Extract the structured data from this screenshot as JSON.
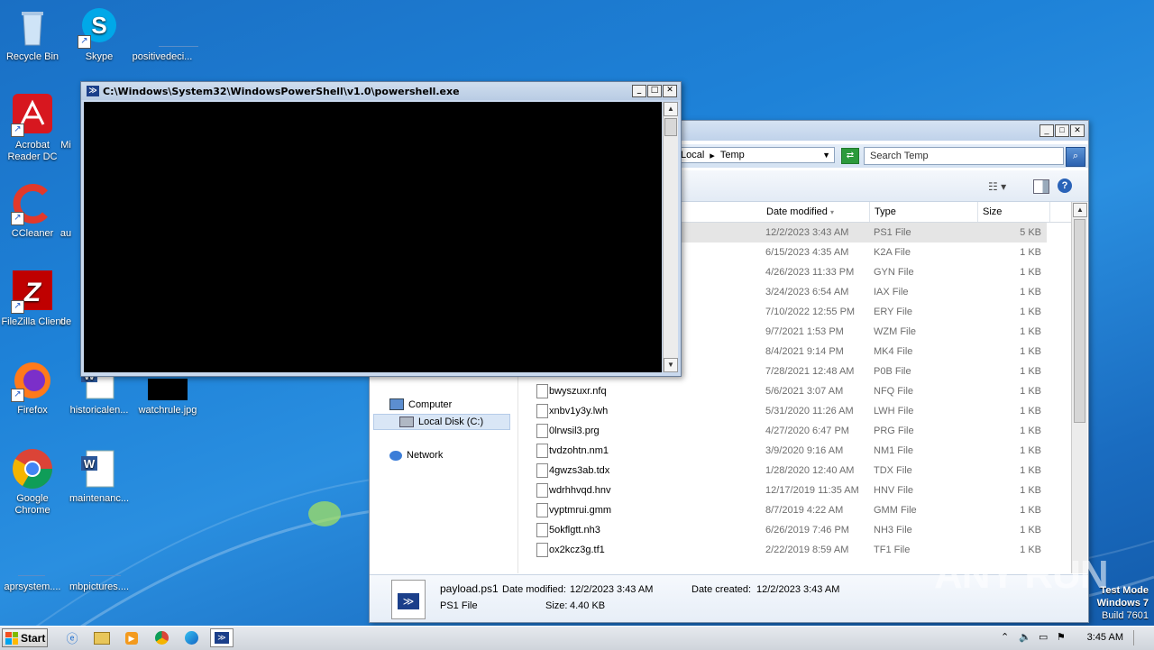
{
  "desktop": {
    "icons": [
      {
        "label": "Recycle Bin",
        "icon": "recycle-bin-icon"
      },
      {
        "label": "Skype",
        "icon": "skype-icon"
      },
      {
        "label": "positivedeci...",
        "icon": "file-icon"
      },
      {
        "label": "Acrobat Reader DC",
        "icon": "acrobat-icon"
      },
      {
        "label": "Mi",
        "icon": "file-icon"
      },
      {
        "label": "CCleaner",
        "icon": "ccleaner-icon"
      },
      {
        "label": "au",
        "icon": "file-icon"
      },
      {
        "label": "FileZilla Client",
        "icon": "filezilla-icon"
      },
      {
        "label": "de",
        "icon": "file-icon"
      },
      {
        "label": "Firefox",
        "icon": "firefox-icon"
      },
      {
        "label": "historicalen...",
        "icon": "word-doc-icon"
      },
      {
        "label": "watchrule.jpg",
        "icon": "image-icon"
      },
      {
        "label": "Google Chrome",
        "icon": "chrome-icon"
      },
      {
        "label": "maintenanc...",
        "icon": "word-doc-icon"
      },
      {
        "label": "aprsystem....",
        "icon": "file-icon"
      },
      {
        "label": "mbpictures....",
        "icon": "file-icon"
      }
    ]
  },
  "powershell": {
    "title": "C:\\Windows\\System32\\WindowsPowerShell\\v1.0\\powershell.exe",
    "btn_min": "_",
    "btn_max": "□",
    "btn_close": "✕"
  },
  "explorer": {
    "btn_min": "_",
    "btn_max": "□",
    "btn_close": "✕",
    "breadcrumb": [
      "Local",
      "Temp"
    ],
    "search_placeholder": "Search Temp",
    "columns": {
      "date": "Date modified",
      "type": "Type",
      "size": "Size"
    },
    "nav": {
      "computer": "Computer",
      "local_disk": "Local Disk (C:)",
      "network": "Network"
    },
    "rows": [
      {
        "name": "",
        "date": "12/2/2023 3:43 AM",
        "type": "PS1 File",
        "size": "5 KB",
        "selected": true
      },
      {
        "name": "",
        "date": "6/15/2023 4:35 AM",
        "type": "K2A File",
        "size": "1 KB"
      },
      {
        "name": "",
        "date": "4/26/2023 11:33 PM",
        "type": "GYN File",
        "size": "1 KB"
      },
      {
        "name": "",
        "date": "3/24/2023 6:54 AM",
        "type": "IAX File",
        "size": "1 KB"
      },
      {
        "name": "",
        "date": "7/10/2022 12:55 PM",
        "type": "ERY File",
        "size": "1 KB"
      },
      {
        "name": "",
        "date": "9/7/2021 1:53 PM",
        "type": "WZM File",
        "size": "1 KB"
      },
      {
        "name": "",
        "date": "8/4/2021 9:14 PM",
        "type": "MK4 File",
        "size": "1 KB"
      },
      {
        "name": "",
        "date": "7/28/2021 12:48 AM",
        "type": "P0B File",
        "size": "1 KB"
      },
      {
        "name": "bwyszuxr.nfq",
        "date": "5/6/2021 3:07 AM",
        "type": "NFQ File",
        "size": "1 KB"
      },
      {
        "name": "xnbv1y3y.lwh",
        "date": "5/31/2020 11:26 AM",
        "type": "LWH File",
        "size": "1 KB"
      },
      {
        "name": "0lrwsil3.prg",
        "date": "4/27/2020 6:47 PM",
        "type": "PRG File",
        "size": "1 KB"
      },
      {
        "name": "tvdzohtn.nm1",
        "date": "3/9/2020 9:16 AM",
        "type": "NM1 File",
        "size": "1 KB"
      },
      {
        "name": "4gwzs3ab.tdx",
        "date": "1/28/2020 12:40 AM",
        "type": "TDX File",
        "size": "1 KB"
      },
      {
        "name": "wdrhhvqd.hnv",
        "date": "12/17/2019 11:35 AM",
        "type": "HNV File",
        "size": "1 KB"
      },
      {
        "name": "vyptmrui.gmm",
        "date": "8/7/2019 4:22 AM",
        "type": "GMM File",
        "size": "1 KB"
      },
      {
        "name": "5okflgtt.nh3",
        "date": "6/26/2019 7:46 PM",
        "type": "NH3 File",
        "size": "1 KB"
      },
      {
        "name": "ox2kcz3g.tf1",
        "date": "2/22/2019 8:59 AM",
        "type": "TF1 File",
        "size": "1 KB"
      }
    ],
    "details": {
      "filename": "payload.ps1",
      "filetype": "PS1 File",
      "modified_label": "Date modified:",
      "modified_value": "12/2/2023 3:43 AM",
      "created_label": "Date created:",
      "created_value": "12/2/2023 3:43 AM",
      "size_label": "Size:",
      "size_value": "4.40 KB"
    }
  },
  "taskbar": {
    "start": "Start",
    "clock": "3:45 AM"
  },
  "watermark": "ANY RUN",
  "testmode": {
    "line1": "Test Mode",
    "line2": "Windows 7",
    "line3": "Build 7601"
  }
}
